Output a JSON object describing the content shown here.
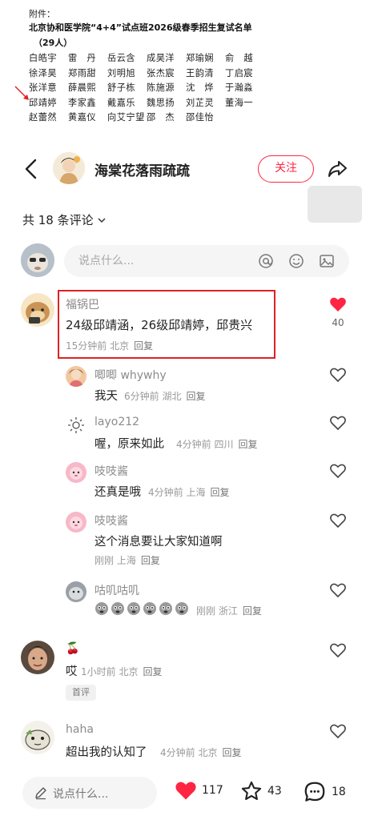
{
  "attachment": {
    "label": "附件：",
    "title": "北京协和医学院“4+4”试点班2026级春季招生复试名单",
    "count": "（29人）",
    "rows": [
      [
        "白皓宇",
        "雷　丹",
        "岳云含",
        "成昊洋",
        "郑瑜娴",
        "俞　越"
      ],
      [
        "徐泽昊",
        "郑雨甜",
        "刘明旭",
        "张杰宸",
        "王韵清",
        "丁启宸"
      ],
      [
        "张洋意",
        "薛晨熙",
        "舒子栋",
        "陈施源",
        "沈　烨",
        "于瀚淼"
      ],
      [
        "邱靖婷",
        "李家鑫",
        "戴嘉乐",
        "魏思扬",
        "刘芷灵",
        "董海一"
      ],
      [
        "赵蕾然",
        "黄嘉仪",
        "向艾宁望",
        "邵　杰",
        "邵佳怡",
        ""
      ]
    ]
  },
  "header": {
    "author_name": "海棠花落雨疏疏",
    "follow_label": "关注"
  },
  "comments_header": {
    "count_label": "共 18 条评论"
  },
  "input": {
    "placeholder": "说点什么..."
  },
  "comments": [
    {
      "user": "福锅巴",
      "text": "24级邱靖涵，26级邱靖婷，邱贵兴",
      "meta": "15分钟前 北京",
      "reply": "回复",
      "likes": "40",
      "liked": true
    },
    {
      "user": "唧唧 whywhy",
      "text": "我天",
      "meta": "6分钟前 湖北",
      "reply": "回复"
    },
    {
      "user": "layo212",
      "text": "喔，原来如此",
      "meta": "4分钟前 四川",
      "reply": "回复"
    },
    {
      "user": "吱吱酱",
      "text": "还真是哦",
      "meta": "4分钟前 上海",
      "reply": "回复"
    },
    {
      "user": "吱吱酱",
      "text": "这个消息要让大家知道啊",
      "meta": "刚刚 上海",
      "reply": "回复"
    },
    {
      "user": "咕叽咕叽",
      "text": "",
      "meta": "刚刚 浙江",
      "reply": "回复"
    },
    {
      "user": "🍒",
      "text": "哎",
      "meta": "1小时前 北京",
      "reply": "回复",
      "tag": "首评"
    },
    {
      "user": "haha",
      "text": "超出我的认知了",
      "meta": "4分钟前 北京",
      "reply": "回复"
    }
  ],
  "bottom_bar": {
    "input_label": "说点什么...",
    "likes": "117",
    "stars": "43",
    "comments": "18"
  },
  "colors": {
    "accent": "#ff2442",
    "highlight_box": "#dd2222"
  }
}
